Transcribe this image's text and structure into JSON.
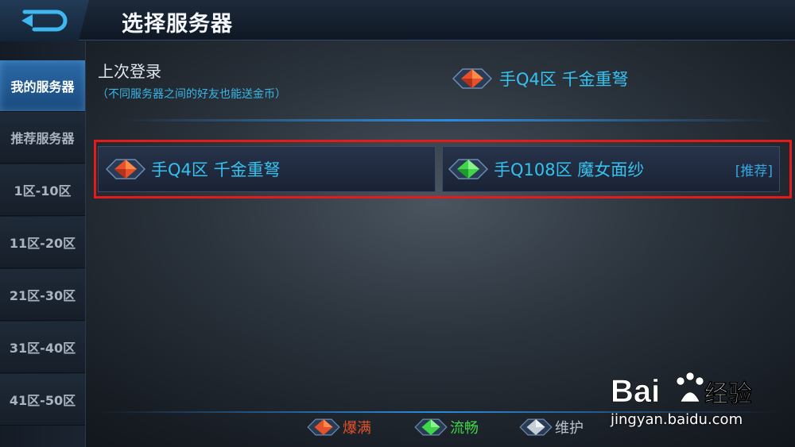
{
  "header": {
    "title": "选择服务器"
  },
  "sidebar": {
    "items": [
      {
        "label": "我的服务器",
        "active": true
      },
      {
        "label": "推荐服务器",
        "active": false
      },
      {
        "label": "1区-10区",
        "active": false
      },
      {
        "label": "11区-20区",
        "active": false
      },
      {
        "label": "21区-30区",
        "active": false
      },
      {
        "label": "31区-40区",
        "active": false
      },
      {
        "label": "41区-50区",
        "active": false
      }
    ]
  },
  "last_login": {
    "label": "上次登录",
    "note": "（不同服务器之间的好友也能送金币）",
    "server": {
      "name": "手Q4区 千金重弩",
      "status": "full",
      "icon": "red-gem-icon"
    }
  },
  "servers": [
    {
      "name": "手Q4区 千金重弩",
      "status": "full",
      "icon": "red-gem-icon",
      "tag": ""
    },
    {
      "name": "手Q108区 魔女面纱",
      "status": "smooth",
      "icon": "green-gem-icon",
      "tag": "[推荐]"
    }
  ],
  "legend": [
    {
      "label": "爆满",
      "color": "#e4512a",
      "icon": "red-gem-icon"
    },
    {
      "label": "流畅",
      "color": "#3fd64a",
      "icon": "green-gem-icon"
    },
    {
      "label": "维护",
      "color": "#b9c2cc",
      "icon": "grey-gem-icon"
    }
  ],
  "watermark": {
    "brand": "Baidu经验",
    "url": "jingyan.baidu.com"
  },
  "colors": {
    "accent": "#35c2ef",
    "highlight_box": "#e41b1b",
    "active_tab": "#2b6aa8"
  }
}
